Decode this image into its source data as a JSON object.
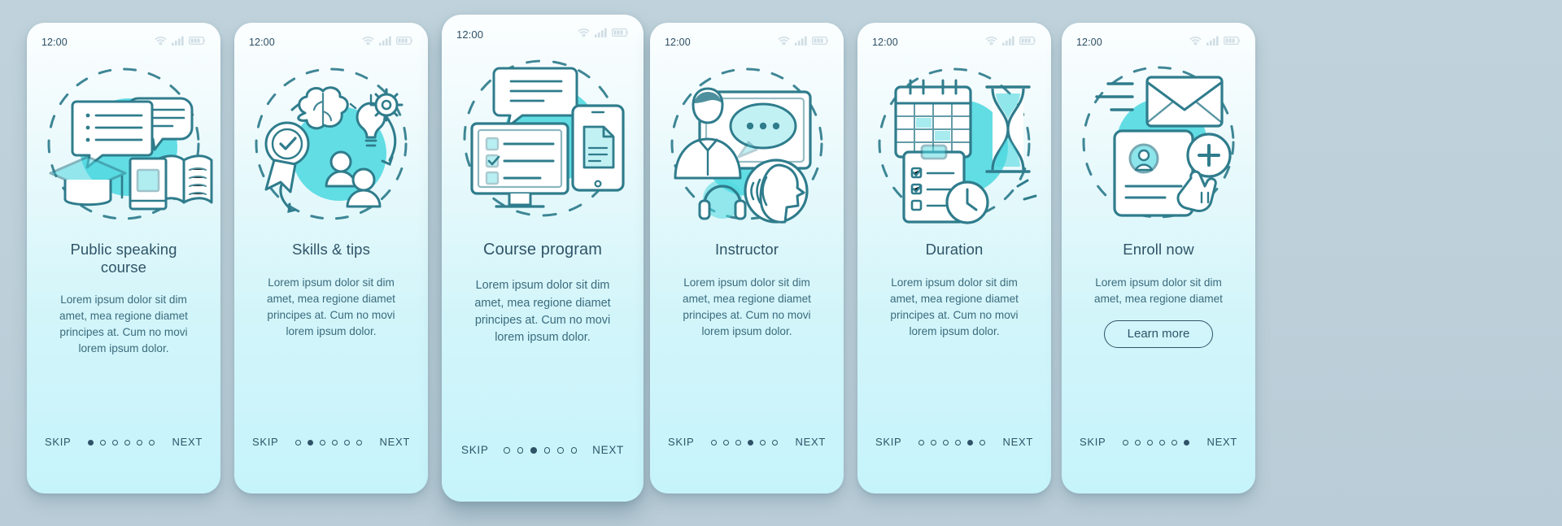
{
  "theme": {
    "background": "#bcd0da",
    "card_top": "#fbfeff",
    "card_bottom": "#c6f4fb",
    "accent": "#4fd8e0",
    "line": "#2f7c8c",
    "text_dark": "#2f5468",
    "text_body": "#3a6b7d"
  },
  "status": {
    "time": "12:00",
    "icons": [
      "wifi-icon",
      "signal-icon",
      "battery-icon"
    ]
  },
  "nav": {
    "skip_label": "SKIP",
    "next_label": "NEXT",
    "total_dots": 6
  },
  "screens": [
    {
      "id": "public-speaking-course",
      "illustration": "graduation-cap-books-chat-illustration",
      "title": "Public speaking course",
      "body": "Lorem ipsum dolor sit dim amet, mea regione diamet principes at. Cum no movi lorem ipsum dolor.",
      "active_dot": 1,
      "cta": null,
      "is_active": false
    },
    {
      "id": "skills-and-tips",
      "illustration": "brain-bulb-badge-users-illustration",
      "title": "Skills & tips",
      "body": "Lorem ipsum dolor sit dim amet, mea regione diamet principes at. Cum no movi lorem ipsum dolor.",
      "active_dot": 2,
      "cta": null,
      "is_active": false
    },
    {
      "id": "course-program",
      "illustration": "monitor-checklist-tablet-illustration",
      "title": "Course program",
      "body": "Lorem ipsum dolor sit dim amet, mea regione diamet principes at. Cum no movi lorem ipsum dolor.",
      "active_dot": 3,
      "cta": null,
      "is_active": true
    },
    {
      "id": "instructor",
      "illustration": "instructor-screen-speech-illustration",
      "title": "Instructor",
      "body": "Lorem ipsum dolor sit dim amet, mea regione diamet principes at. Cum no movi lorem ipsum dolor.",
      "active_dot": 4,
      "cta": null,
      "is_active": false
    },
    {
      "id": "duration",
      "illustration": "calendar-hourglass-clipboard-clock-illustration",
      "title": "Duration",
      "body": "Lorem ipsum dolor sit dim amet, mea regione diamet principes at. Cum no movi lorem ipsum dolor.",
      "active_dot": 5,
      "cta": null,
      "is_active": false
    },
    {
      "id": "enroll-now",
      "illustration": "envelope-profile-card-plus-cursor-illustration",
      "title": "Enroll now",
      "body": "Lorem ipsum dolor sit dim amet, mea regione diamet",
      "active_dot": 6,
      "cta": "Learn more",
      "is_active": false
    }
  ]
}
